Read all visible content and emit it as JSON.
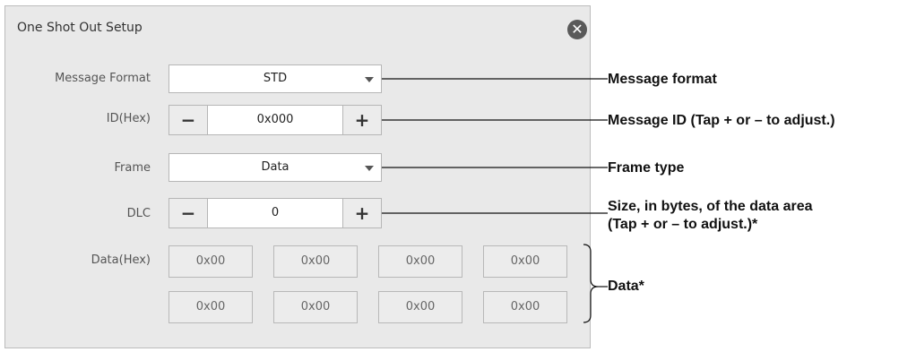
{
  "dialog": {
    "title": "One Shot Out Setup",
    "close_glyph": "✕"
  },
  "fields": {
    "message_format": {
      "label": "Message Format",
      "value": "STD"
    },
    "id_hex": {
      "label": "ID(Hex)",
      "value": "0x000",
      "minus": "−",
      "plus": "+"
    },
    "frame": {
      "label": "Frame",
      "value": "Data"
    },
    "dlc": {
      "label": "DLC",
      "value": "0",
      "minus": "−",
      "plus": "+"
    },
    "data_hex": {
      "label": "Data(Hex)",
      "bytes": [
        "0x00",
        "0x00",
        "0x00",
        "0x00",
        "0x00",
        "0x00",
        "0x00",
        "0x00"
      ]
    }
  },
  "annotations": {
    "message_format": "Message format",
    "message_id": "Message ID (Tap + or – to adjust.)",
    "frame_type": "Frame type",
    "size_line1": "Size, in bytes, of the data area",
    "size_line2": "(Tap + or – to adjust.)*",
    "data": "Data*"
  },
  "icons": {
    "close": "close-circle-icon",
    "dropdown": "chevron-down-icon"
  },
  "colors": {
    "panel": "#e9e9e9",
    "border": "#b6b6b6",
    "annotation_text": "#111111"
  }
}
